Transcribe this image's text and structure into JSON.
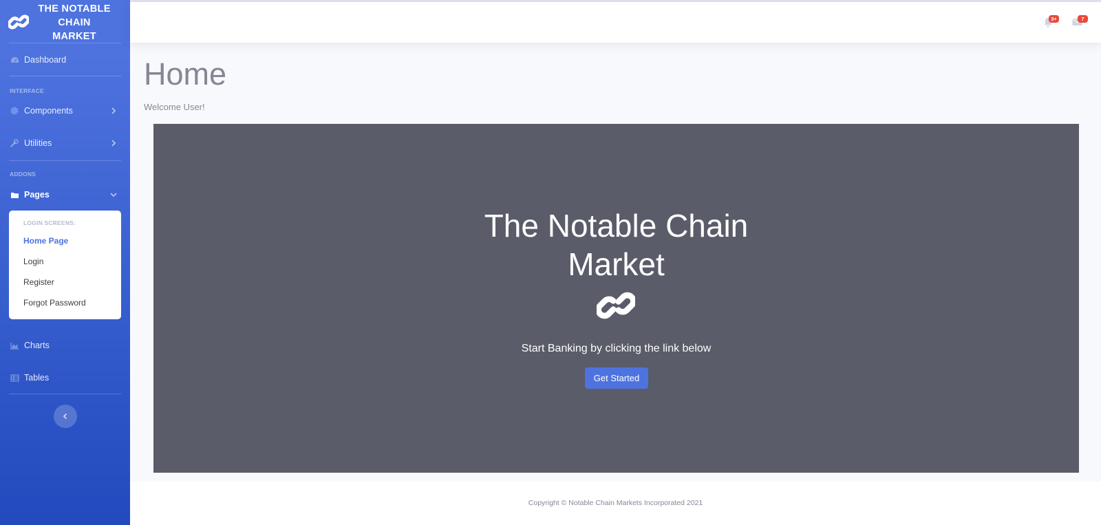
{
  "sidebar": {
    "brand": {
      "text": "THE NOTABLE CHAIN MARKET",
      "icon": "link-icon"
    },
    "dashboard_label": "Dashboard",
    "heading_interface": "INTERFACE",
    "components_label": "Components",
    "utilities_label": "Utilities",
    "heading_addons": "ADDONS",
    "pages_label": "Pages",
    "pages_submenu": {
      "header": "LOGIN SCREENS:",
      "items": [
        "Home Page",
        "Login",
        "Register",
        "Forgot Password"
      ],
      "active": "Home Page"
    },
    "charts_label": "Charts",
    "tables_label": "Tables"
  },
  "topbar": {
    "alerts_badge": "3+",
    "messages_badge": "7"
  },
  "main": {
    "title": "Home",
    "welcome": "Welcome User!",
    "hero": {
      "title_line1": "The Notable Chain",
      "title_line2": "Market",
      "subtitle": "Start Banking by clicking the link below",
      "button": "Get Started"
    }
  },
  "footer": {
    "copyright": "Copyright © Notable Chain Markets Incorporated 2021"
  },
  "colors": {
    "primary": "#4e73df",
    "sidebar_dark": "#224abe",
    "hero_bg": "#5a5c69",
    "badge": "#e74a3b",
    "text_muted": "#858796"
  }
}
